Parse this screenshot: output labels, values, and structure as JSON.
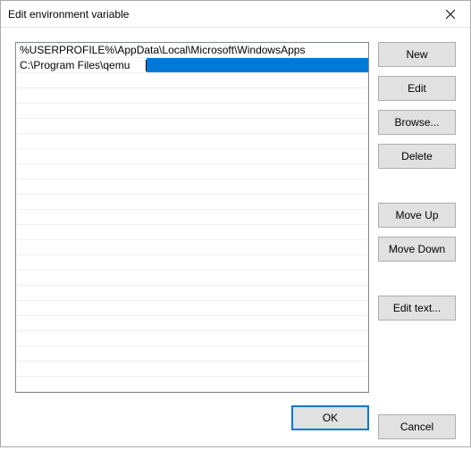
{
  "window": {
    "title": "Edit environment variable"
  },
  "list": {
    "rows": [
      "%USERPROFILE%\\AppData\\Local\\Microsoft\\WindowsApps",
      "C:\\Program Files\\qemu"
    ],
    "editing_index": 1
  },
  "buttons": {
    "new": "New",
    "edit": "Edit",
    "browse": "Browse...",
    "delete": "Delete",
    "move_up": "Move Up",
    "move_down": "Move Down",
    "edit_text": "Edit text...",
    "ok": "OK",
    "cancel": "Cancel"
  }
}
